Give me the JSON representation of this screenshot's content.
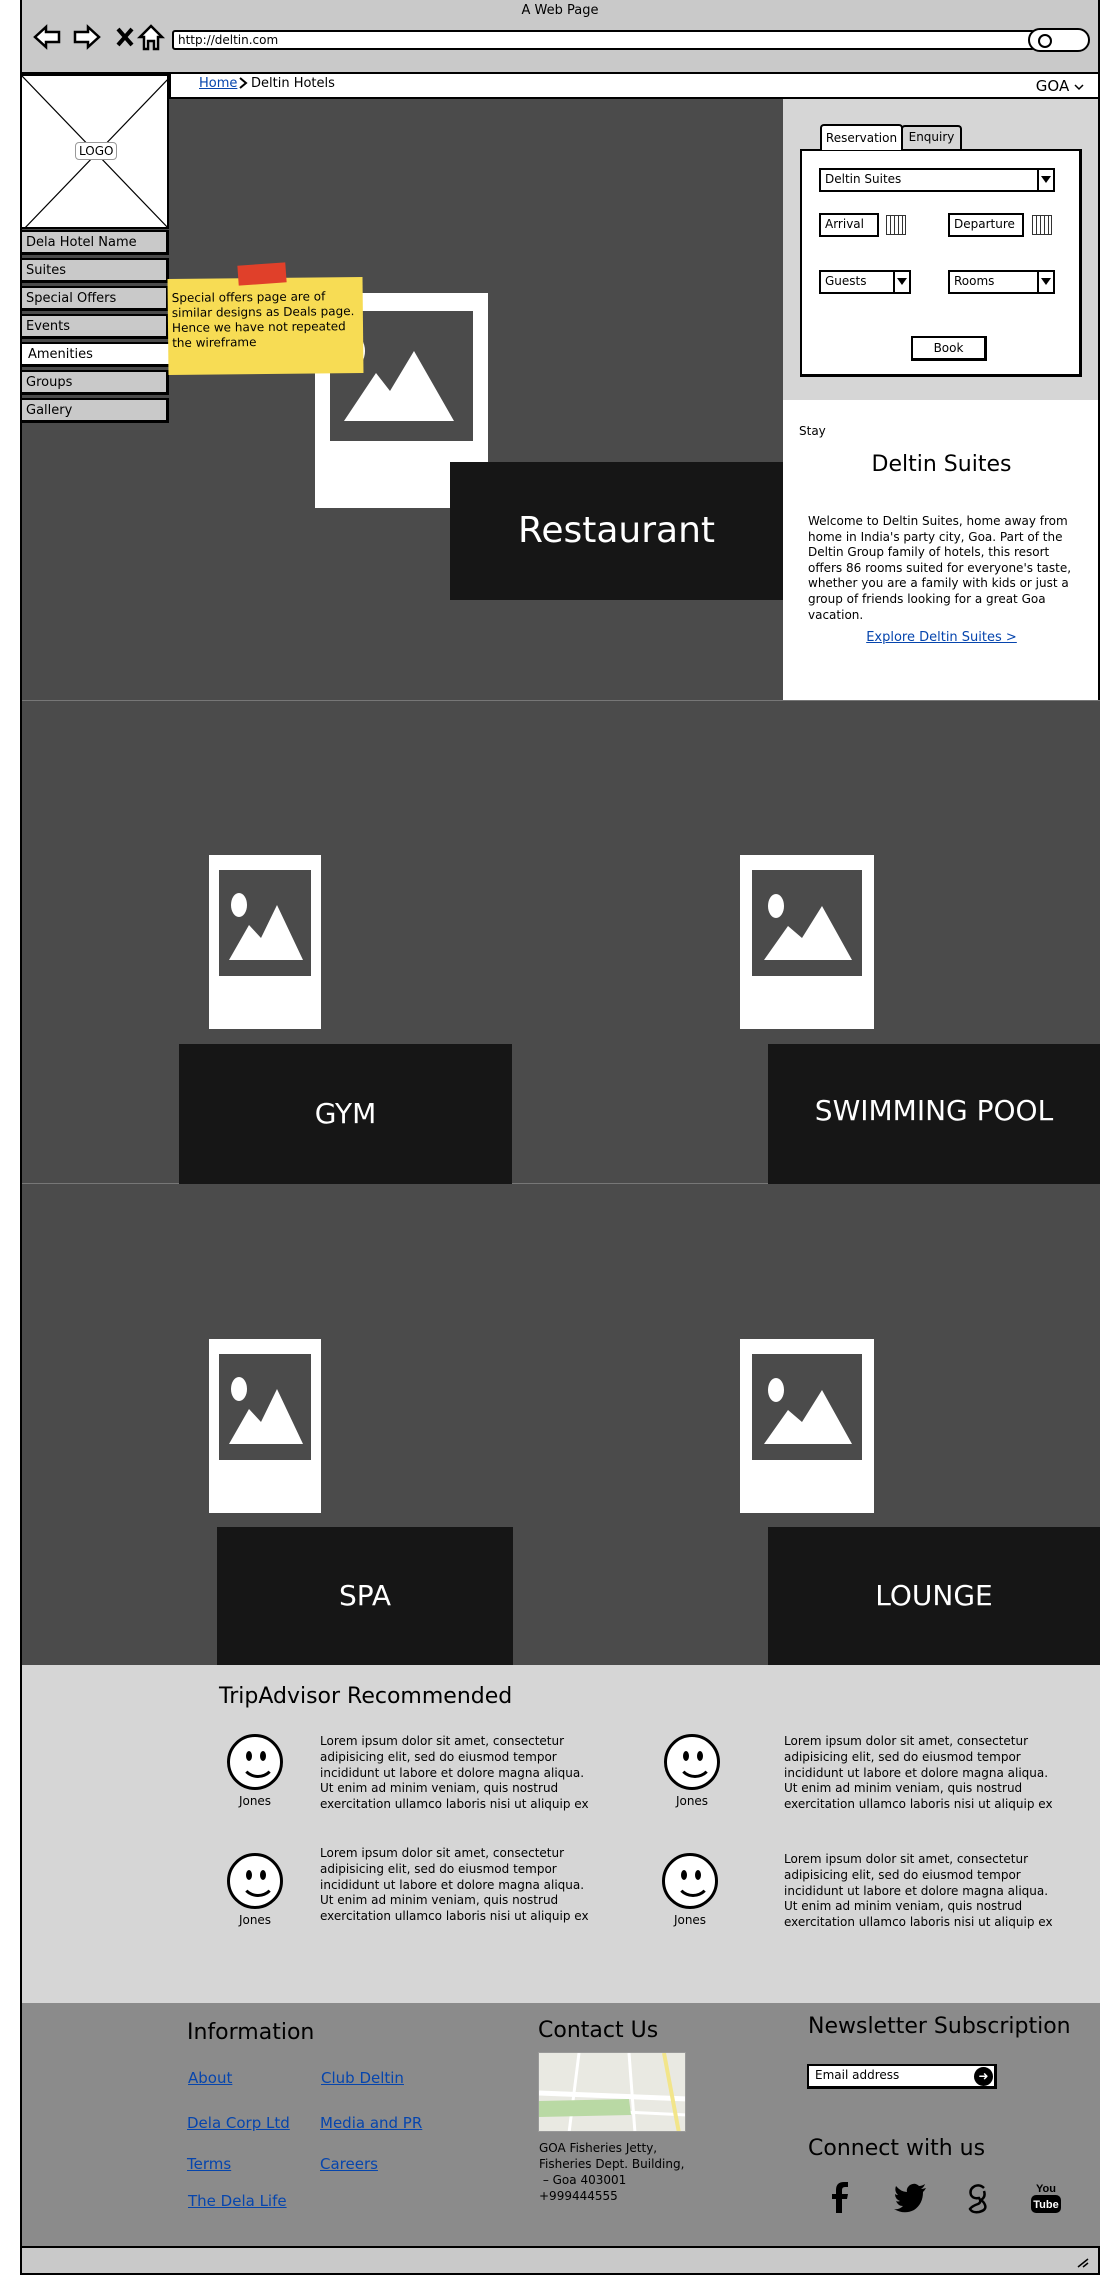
{
  "window": {
    "title": "A Web Page",
    "url": "http://deltin.com"
  },
  "breadcrumb": {
    "home": "Home",
    "current": "Deltin Hotels",
    "location": "GOA"
  },
  "logo": {
    "label": "LOGO"
  },
  "sidebar": {
    "items": [
      {
        "label": "Dela Hotel Name"
      },
      {
        "label": "Suites"
      },
      {
        "label": "Special Offers"
      },
      {
        "label": "Events"
      },
      {
        "label": "Amenities"
      },
      {
        "label": "Groups"
      },
      {
        "label": "Gallery"
      }
    ],
    "active_index": 4
  },
  "sticky_note": {
    "text": "Special offers page are of similar designs as Deals page. Hence we have not repeated the wireframe"
  },
  "hero": {
    "restaurant_label": "Restaurant"
  },
  "booking": {
    "tabs": [
      {
        "label": "Reservation"
      },
      {
        "label": "Enquiry"
      }
    ],
    "hotel_select": "Deltin Suites",
    "arrival": "Arrival",
    "departure": "Departure",
    "guests": "Guests",
    "rooms": "Rooms",
    "book_label": "Book"
  },
  "stay": {
    "label": "Stay",
    "title": "Deltin Suites",
    "description": "Welcome to Deltin Suites, home away from home in India's party city, Goa. Part of the Deltin Group family of hotels, this resort offers 86 rooms suited for everyone's taste, whether you are a family with kids or just a group of friends looking for a great Goa vacation.",
    "link": "Explore Deltin Suites >"
  },
  "amenities": [
    {
      "label": "GYM"
    },
    {
      "label": "SWIMMING POOL"
    },
    {
      "label": "SPA"
    },
    {
      "label": "LOUNGE"
    }
  ],
  "tripadvisor": {
    "title": "TripAdvisor Recommended",
    "reviews": [
      {
        "name": "Jones",
        "text": "Lorem ipsum dolor sit amet, consectetur adipisicing elit, sed do eiusmod tempor incididunt ut labore et dolore magna aliqua. Ut enim ad minim veniam, quis nostrud exercitation ullamco laboris nisi ut aliquip ex"
      },
      {
        "name": "Jones",
        "text": "Lorem ipsum dolor sit amet, consectetur adipisicing elit, sed do eiusmod tempor incididunt ut labore et dolore magna aliqua. Ut enim ad minim veniam, quis nostrud exercitation ullamco laboris nisi ut aliquip ex"
      },
      {
        "name": "Jones",
        "text": "Lorem ipsum dolor sit amet, consectetur adipisicing elit, sed do eiusmod tempor incididunt ut labore et dolore magna aliqua. Ut enim ad minim veniam, quis nostrud exercitation ullamco laboris nisi ut aliquip ex"
      },
      {
        "name": "Jones",
        "text": "Lorem ipsum dolor sit amet, consectetur adipisicing elit, sed do eiusmod tempor incididunt ut labore et dolore magna aliqua. Ut enim ad minim veniam, quis nostrud exercitation ullamco laboris nisi ut aliquip ex"
      }
    ]
  },
  "footer": {
    "information": {
      "title": "Information",
      "links": [
        {
          "label": "About"
        },
        {
          "label": "Club Deltin"
        },
        {
          "label": "Dela Corp Ltd"
        },
        {
          "label": "Media and PR"
        },
        {
          "label": "Terms"
        },
        {
          "label": "Careers"
        },
        {
          "label": "The Dela Life"
        }
      ]
    },
    "contact": {
      "title": "Contact Us",
      "address_lines": [
        "GOA Fisheries Jetty,",
        "Fisheries Dept. Building,",
        " – Goa 403001",
        "+999444555"
      ]
    },
    "newsletter": {
      "title": "Newsletter Subscription",
      "placeholder": "Email address"
    },
    "connect": {
      "title": "Connect with us",
      "icons": [
        "facebook-icon",
        "twitter-icon",
        "google-icon",
        "youtube-icon"
      ],
      "youtube_text": "You Tube"
    }
  },
  "colors": {
    "dark": "#4b4b4b",
    "panel": "#161616",
    "light": "#d6d6d6",
    "footer": "#8b8b8b",
    "link": "#0645ad",
    "sticky": "#f7dc54"
  }
}
